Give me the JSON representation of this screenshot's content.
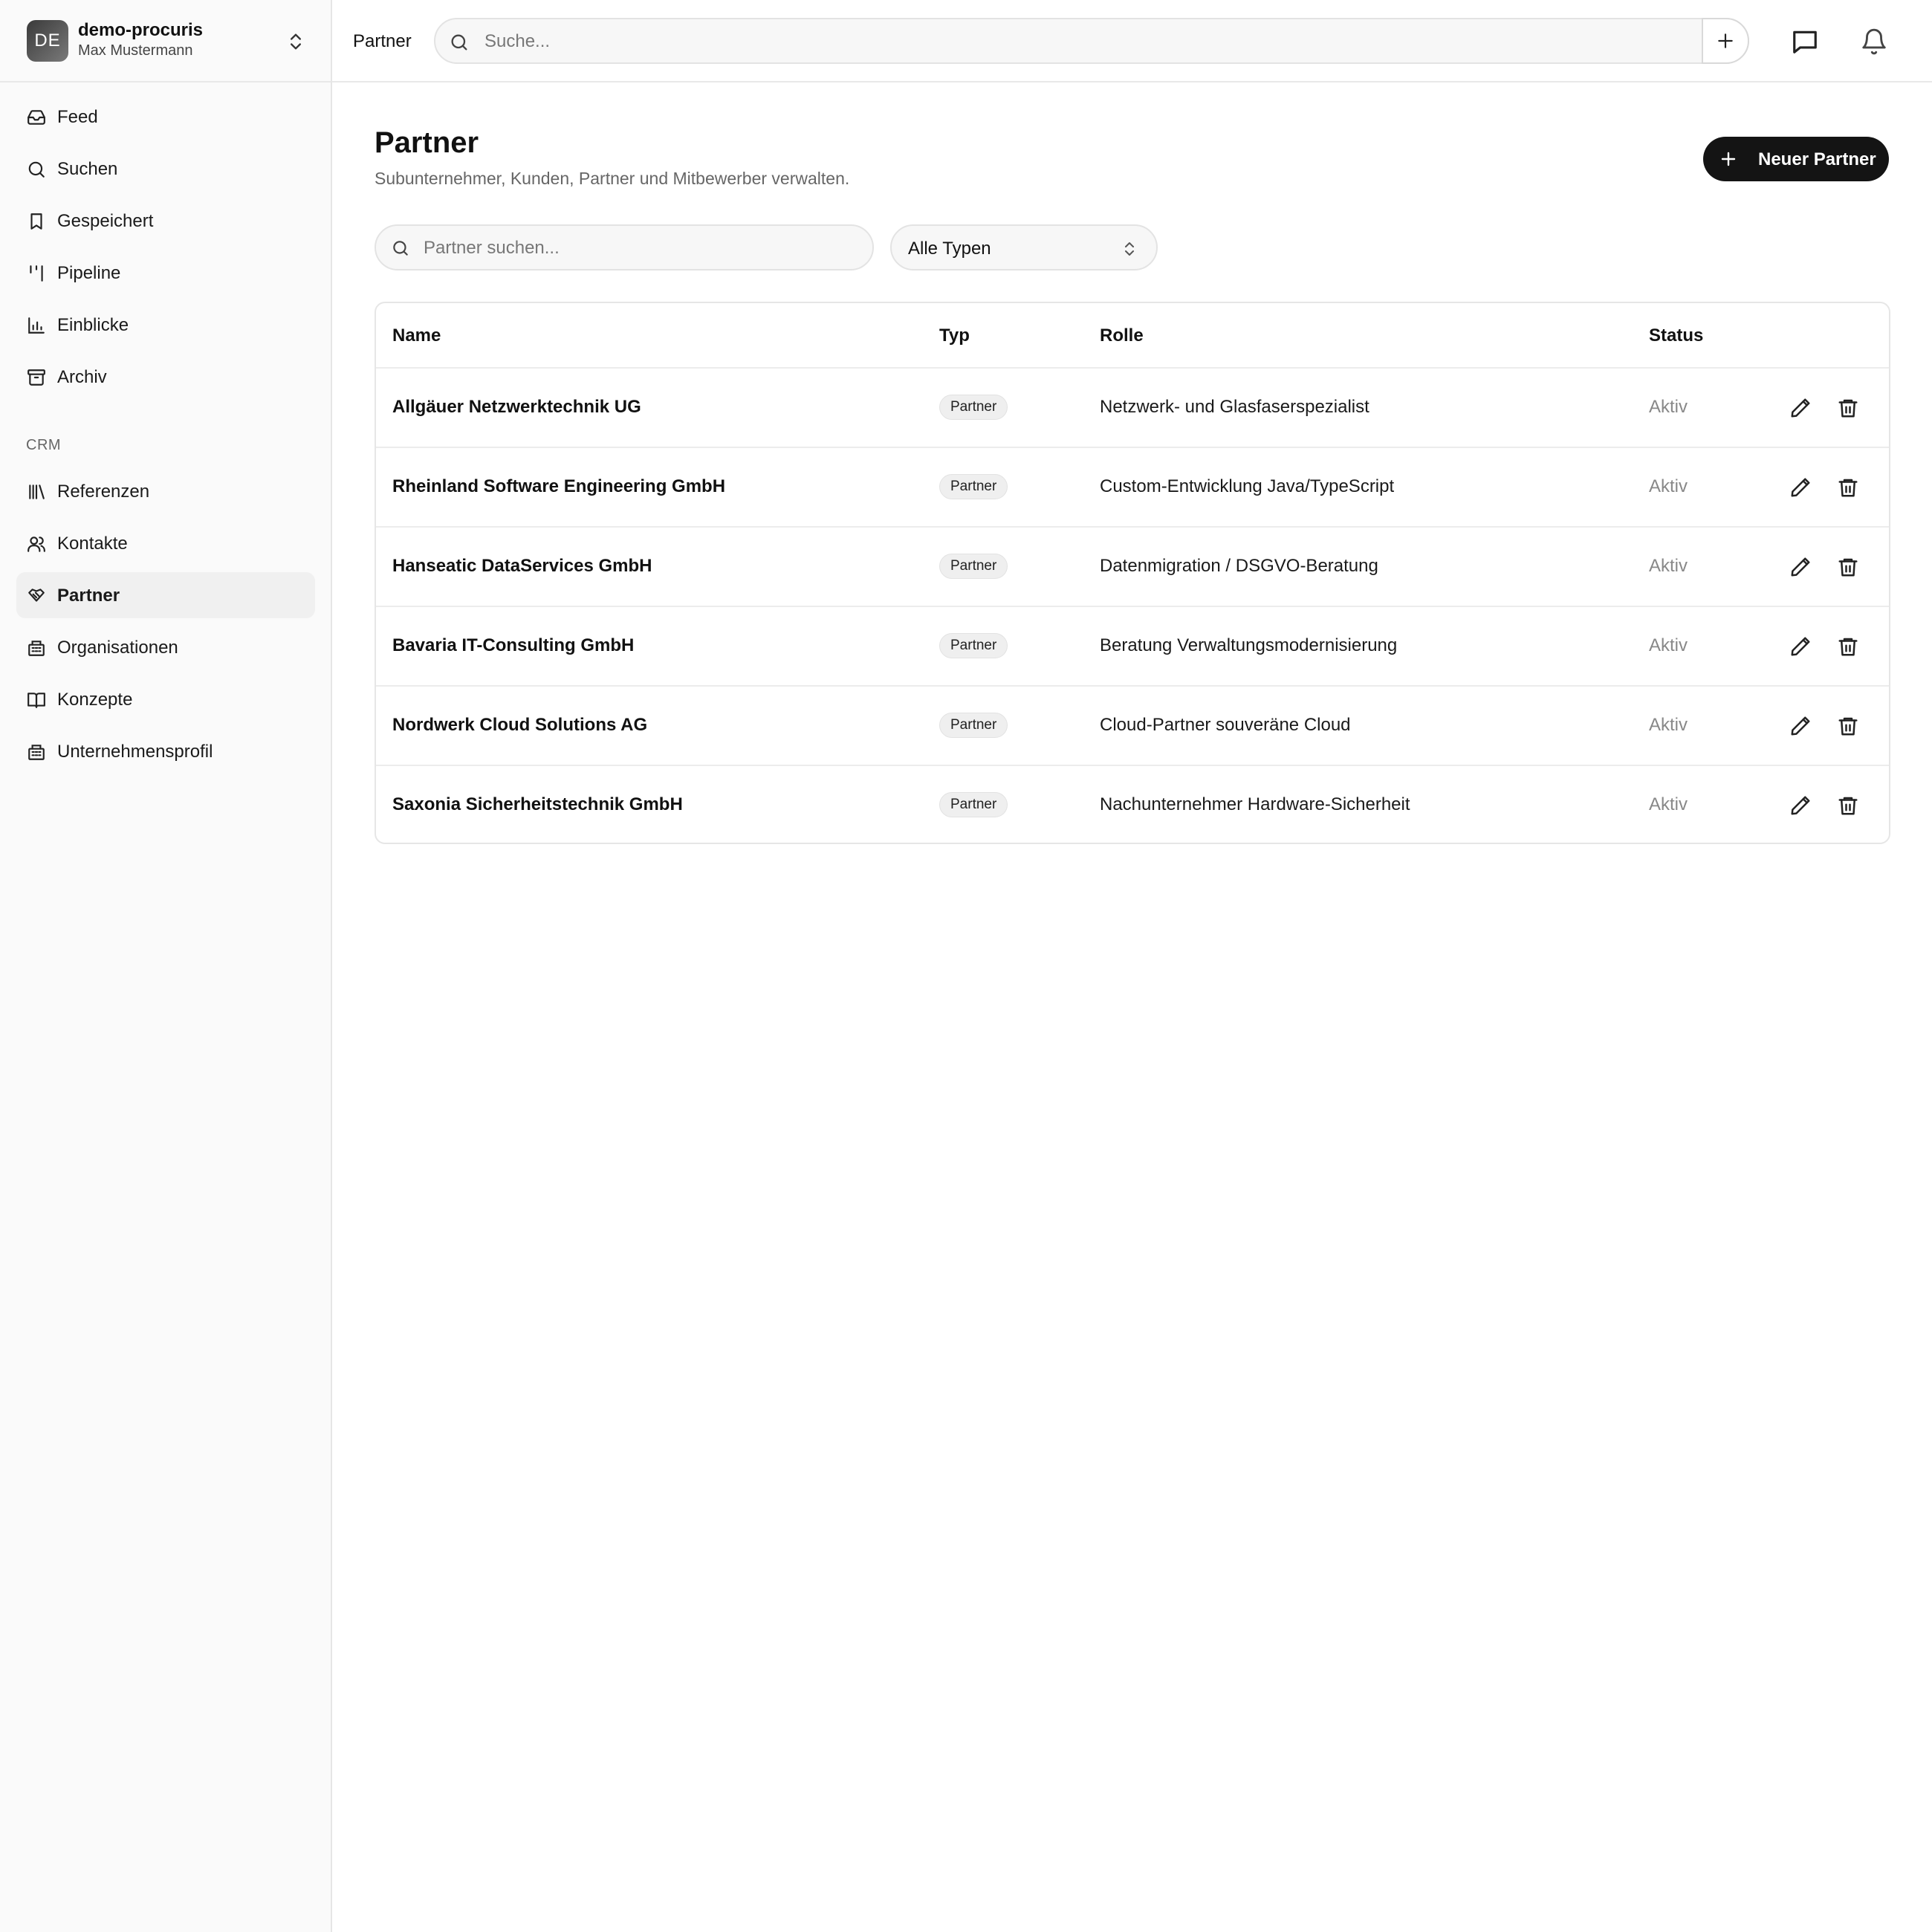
{
  "org": {
    "initials": "DE",
    "name": "demo-procuris",
    "user": "Max Mustermann"
  },
  "sidebar": {
    "items": [
      {
        "label": "Feed",
        "icon": "inbox-icon"
      },
      {
        "label": "Suchen",
        "icon": "search-icon"
      },
      {
        "label": "Gespeichert",
        "icon": "bookmark-icon"
      },
      {
        "label": "Pipeline",
        "icon": "kanban-icon"
      },
      {
        "label": "Einblicke",
        "icon": "bar-chart-icon"
      },
      {
        "label": "Archiv",
        "icon": "archive-icon"
      }
    ],
    "section_label": "CRM",
    "crm_items": [
      {
        "label": "Referenzen",
        "icon": "library-icon"
      },
      {
        "label": "Kontakte",
        "icon": "users-icon"
      },
      {
        "label": "Partner",
        "icon": "handshake-icon",
        "active": true
      },
      {
        "label": "Organisationen",
        "icon": "building-icon"
      },
      {
        "label": "Konzepte",
        "icon": "book-open-icon"
      },
      {
        "label": "Unternehmensprofil",
        "icon": "building-icon"
      }
    ]
  },
  "topbar": {
    "breadcrumb": "Partner",
    "search_placeholder": "Suche..."
  },
  "page": {
    "title": "Partner",
    "subtitle": "Subunternehmer, Kunden, Partner und Mitbewerber verwalten.",
    "new_button": "Neuer Partner",
    "search_placeholder": "Partner suchen...",
    "type_filter": "Alle Typen"
  },
  "table": {
    "columns": [
      "Name",
      "Typ",
      "Rolle",
      "Status"
    ],
    "rows": [
      {
        "name": "Allgäuer Netzwerktechnik UG",
        "type": "Partner",
        "role": "Netzwerk- und Glasfaserspezialist",
        "status": "Aktiv"
      },
      {
        "name": "Rheinland Software Engineering GmbH",
        "type": "Partner",
        "role": "Custom-Entwicklung Java/TypeScript",
        "status": "Aktiv"
      },
      {
        "name": "Hanseatic DataServices GmbH",
        "type": "Partner",
        "role": "Datenmigration / DSGVO-Beratung",
        "status": "Aktiv"
      },
      {
        "name": "Bavaria IT-Consulting GmbH",
        "type": "Partner",
        "role": "Beratung Verwaltungsmodernisierung",
        "status": "Aktiv"
      },
      {
        "name": "Nordwerk Cloud Solutions AG",
        "type": "Partner",
        "role": "Cloud-Partner souveräne Cloud",
        "status": "Aktiv"
      },
      {
        "name": "Saxonia Sicherheitstechnik GmbH",
        "type": "Partner",
        "role": "Nachunternehmer Hardware-Sicherheit",
        "status": "Aktiv"
      }
    ]
  },
  "colors": {
    "primary_button": "#141414",
    "sidebar_bg": "#fafafa",
    "muted_text": "#888888"
  }
}
